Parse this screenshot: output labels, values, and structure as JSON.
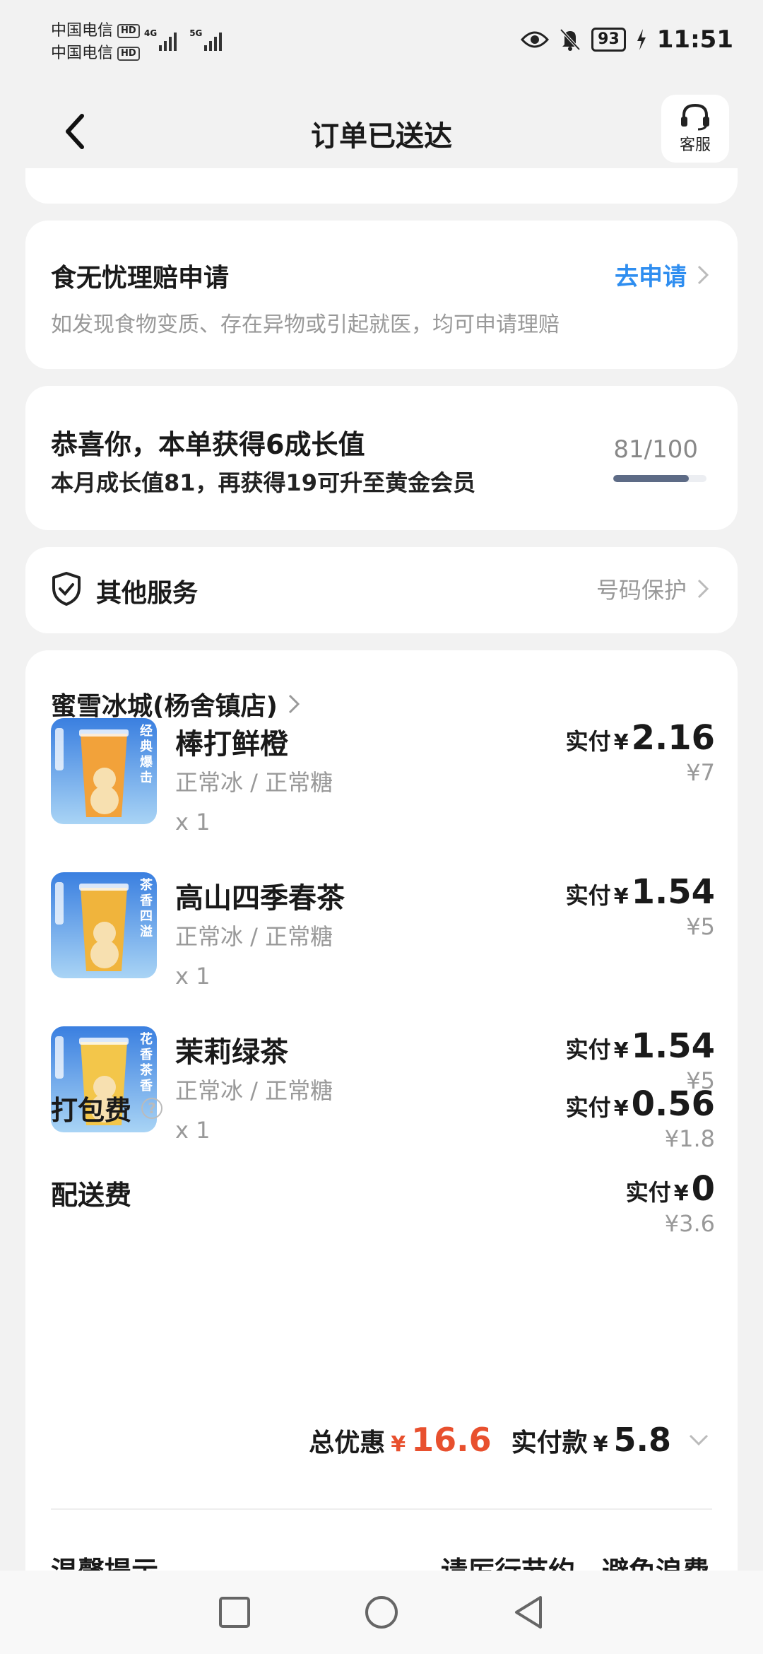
{
  "status_bar": {
    "carrier1": "中国电信",
    "carrier2": "中国电信",
    "hd": "HD",
    "net1": "4G",
    "net2": "5G",
    "battery": "93",
    "time": "11:51"
  },
  "header": {
    "title": "订单已送达",
    "service_label": "客服"
  },
  "claim": {
    "title": "食无忧理赔申请",
    "link": "去申请",
    "desc": "如发现食物变质、存在异物或引起就医，均可申请理赔"
  },
  "growth": {
    "title": "恭喜你，本单获得6成长值",
    "desc": "本月成长值81，再获得19可升至黄金会员",
    "score": "81/100",
    "progress": 0.81
  },
  "services": {
    "title": "其他服务",
    "right": "号码保护"
  },
  "order": {
    "store": "蜜雪冰城(杨舍镇店)",
    "items": [
      {
        "name": "棒打鲜橙",
        "spec": "正常冰 / 正常糖",
        "qty": "x 1",
        "paid_label": "实付",
        "currency": "¥",
        "paid": "2.16",
        "original": "¥7",
        "badge": "经典爆击",
        "color": "#f2a23a"
      },
      {
        "name": "高山四季春茶",
        "spec": "正常冰 / 正常糖",
        "qty": "x 1",
        "paid_label": "实付",
        "currency": "¥",
        "paid": "1.54",
        "original": "¥5",
        "badge": "茶香四溢",
        "color": "#f0b43c"
      },
      {
        "name": "茉莉绿茶",
        "spec": "正常冰 / 正常糖",
        "qty": "x 1",
        "paid_label": "实付",
        "currency": "¥",
        "paid": "1.54",
        "original": "¥5",
        "badge": "花香茶香",
        "color": "#f3c64a"
      }
    ],
    "packing": {
      "label": "打包费",
      "paid_label": "实付",
      "currency": "¥",
      "paid": "0.56",
      "original": "¥1.8"
    },
    "delivery": {
      "label": "配送费",
      "paid_label": "实付",
      "currency": "¥",
      "paid": "0",
      "original": "¥3.6"
    },
    "totals": {
      "discount_label": "总优惠",
      "discount_currency": "¥",
      "discount": "16.6",
      "paid_label": "实付款",
      "paid_currency": "¥",
      "paid": "5.8"
    },
    "tips_title": "温馨提示",
    "tips_right": "请厉行节约，避免浪费"
  },
  "colors": {
    "accent_blue": "#2f8ef0",
    "discount_red": "#e8502e",
    "progress": "#5d6b86"
  }
}
